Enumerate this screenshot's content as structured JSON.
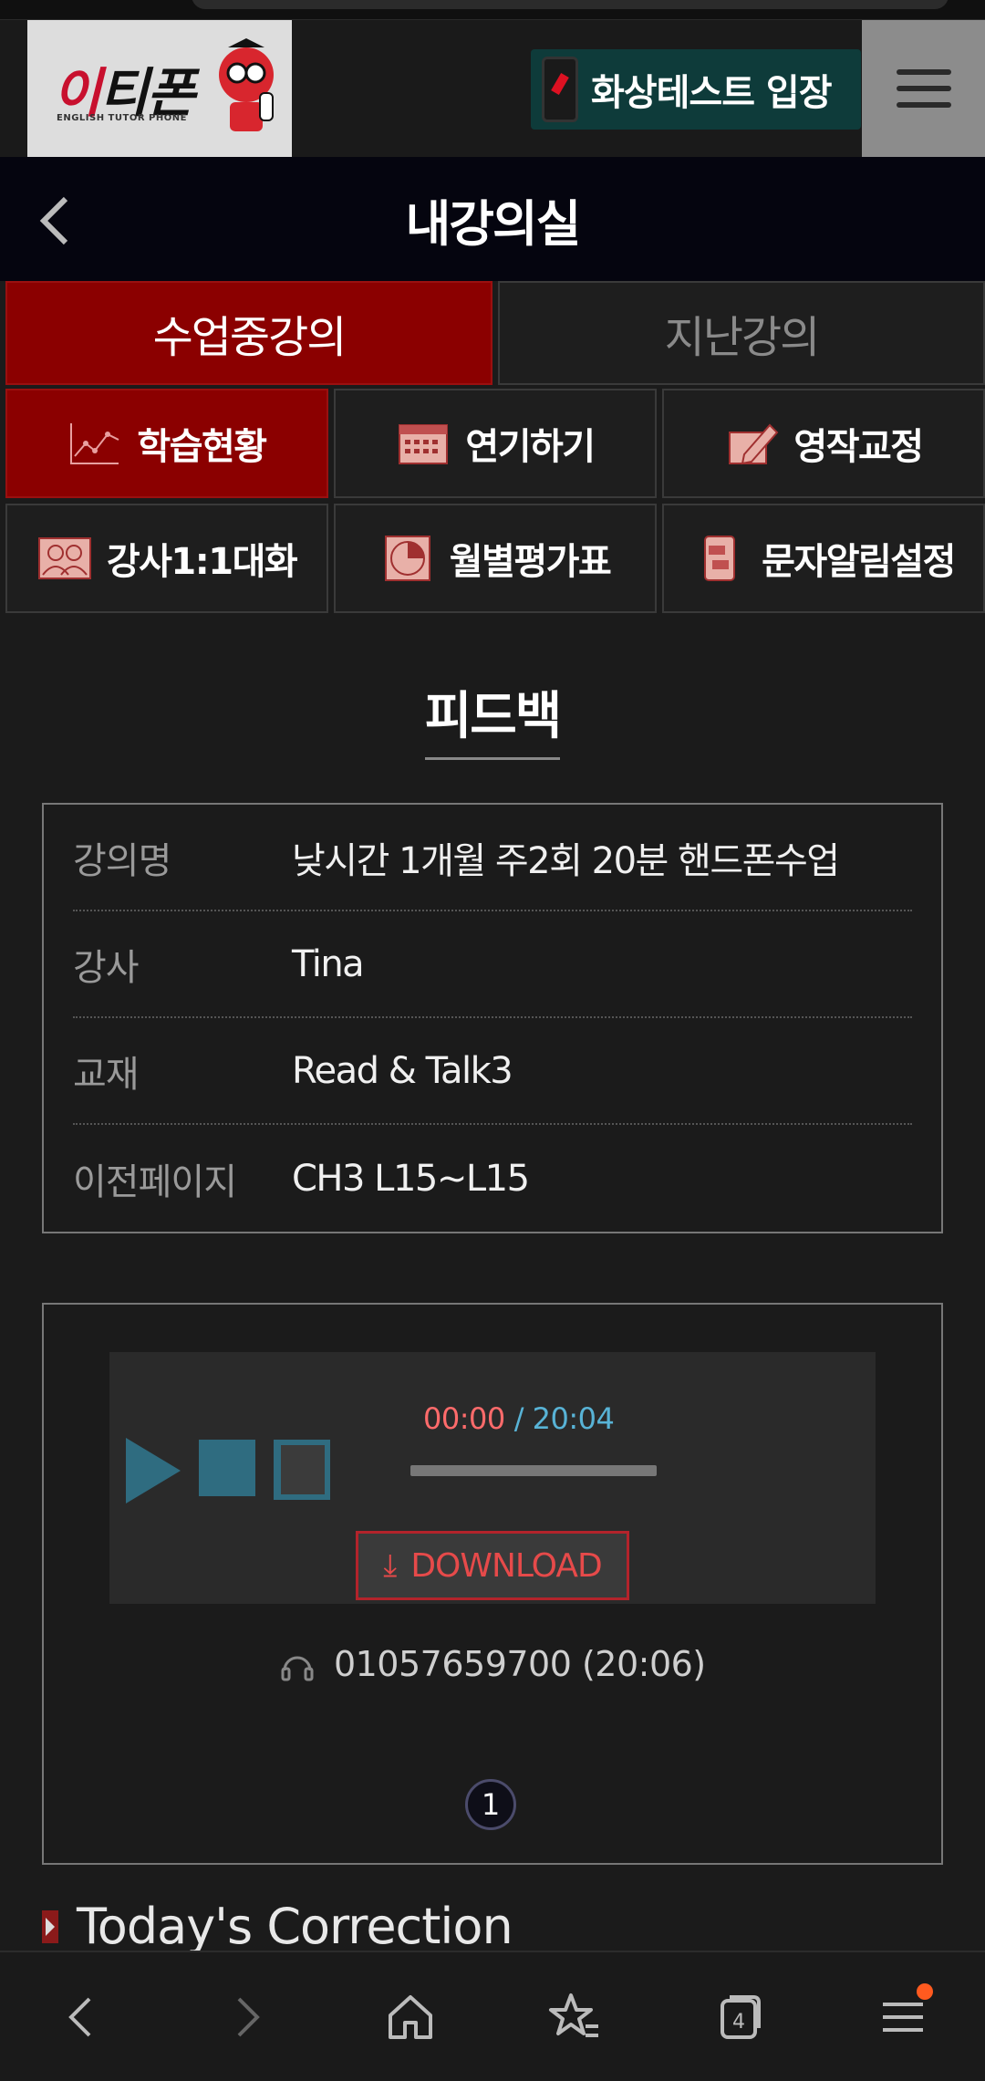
{
  "header": {
    "logo_text": "이티폰",
    "logo_sub": "ENGLISH TUTOR PHONE",
    "video_test_label": "화상테스트 입장"
  },
  "title_bar": {
    "title": "내강의실"
  },
  "main_tabs": [
    {
      "label": "수업중강의",
      "active": true
    },
    {
      "label": "지난강의",
      "active": false
    }
  ],
  "sub_menu": [
    {
      "label": "학습현황",
      "icon": "chart-icon",
      "active": true
    },
    {
      "label": "연기하기",
      "icon": "calendar-icon",
      "active": false
    },
    {
      "label": "영작교정",
      "icon": "pencil-icon",
      "active": false
    },
    {
      "label": "강사1:1대화",
      "icon": "people-icon",
      "active": false
    },
    {
      "label": "월별평가표",
      "icon": "pie-icon",
      "active": false
    },
    {
      "label": "문자알림설정",
      "icon": "message-icon",
      "active": false
    }
  ],
  "section": {
    "title": "피드백"
  },
  "info": [
    {
      "key": "강의명",
      "value": "낮시간 1개월 주2회 20분 핸드폰수업"
    },
    {
      "key": "강사",
      "value": "Tina"
    },
    {
      "key": "교재",
      "value": "Read & Talk3"
    },
    {
      "key": "이전페이지",
      "value": "CH3 L15~L15"
    }
  ],
  "player": {
    "current_time": "00:00",
    "total_time": "/ 20:04",
    "progress": 0,
    "download_label": "DOWNLOAD",
    "phone_record": "01057659700 (20:06)",
    "page_number": "1"
  },
  "correction": {
    "title": "Today's Correction"
  },
  "browser_nav": {
    "tab_count": "4"
  },
  "colors": {
    "accent_red": "#8b0000",
    "teal": "#2f6c80",
    "time_current": "#ff6b6b",
    "time_total": "#58b3d6"
  }
}
